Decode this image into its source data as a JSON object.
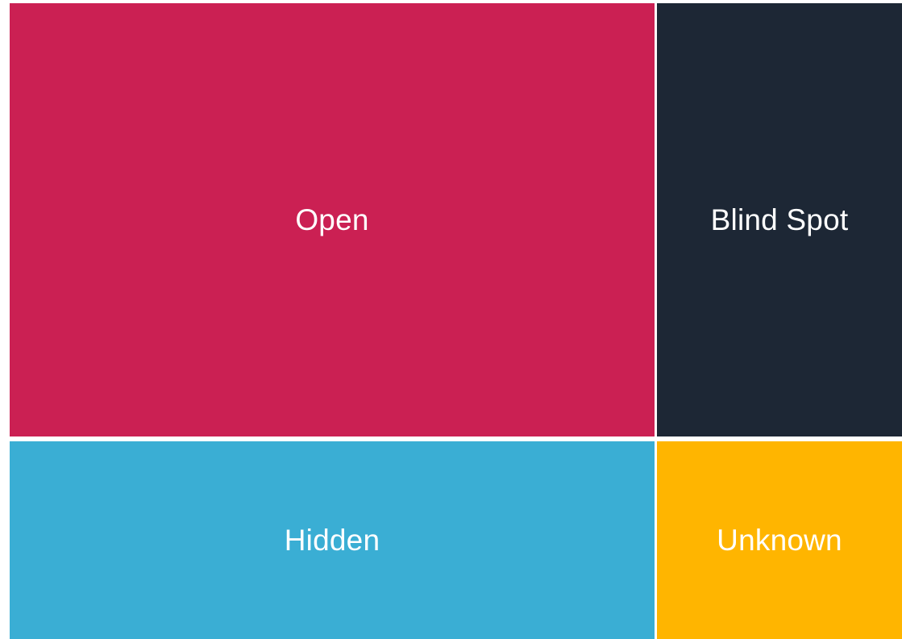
{
  "quadrants": {
    "open": {
      "label": "Open",
      "color": "#cb2053"
    },
    "blind": {
      "label": "Blind Spot",
      "color": "#1d2735"
    },
    "hidden": {
      "label": "Hidden",
      "color": "#3aaed4"
    },
    "unknown": {
      "label": "Unknown",
      "color": "#ffb500"
    }
  }
}
